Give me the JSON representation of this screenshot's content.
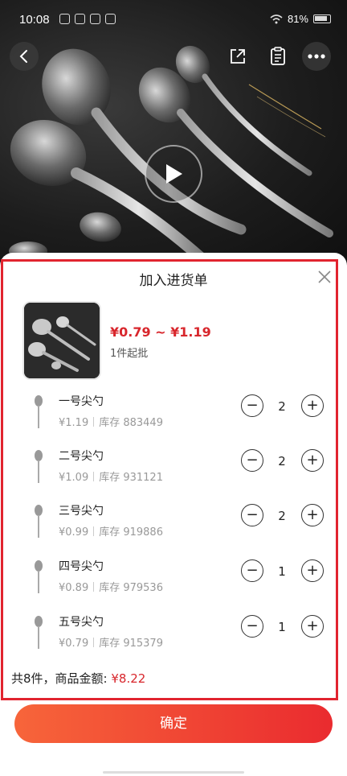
{
  "status_bar": {
    "time": "10:08",
    "battery": "81%"
  },
  "sheet": {
    "title": "加入进货单",
    "product": {
      "price_range": "¥0.79 ~ ¥1.19",
      "min_order": "1件起批"
    },
    "skus": [
      {
        "name": "一号尖勺",
        "price": "¥1.19",
        "stock": "库存 883449",
        "qty": "2"
      },
      {
        "name": "二号尖勺",
        "price": "¥1.09",
        "stock": "库存 931121",
        "qty": "2"
      },
      {
        "name": "三号尖勺",
        "price": "¥0.99",
        "stock": "库存 919886",
        "qty": "2"
      },
      {
        "name": "四号尖勺",
        "price": "¥0.89",
        "stock": "库存 979536",
        "qty": "1"
      },
      {
        "name": "五号尖勺",
        "price": "¥0.79",
        "stock": "库存 915379",
        "qty": "1"
      }
    ],
    "total_label": "共8件，商品金额: ",
    "total_amount": "¥8.22"
  },
  "confirm_label": "确定",
  "colors": {
    "accent": "#d8262c",
    "button_start": "#f7653a",
    "button_end": "#ea2b2f",
    "highlight": "#e1242f"
  }
}
